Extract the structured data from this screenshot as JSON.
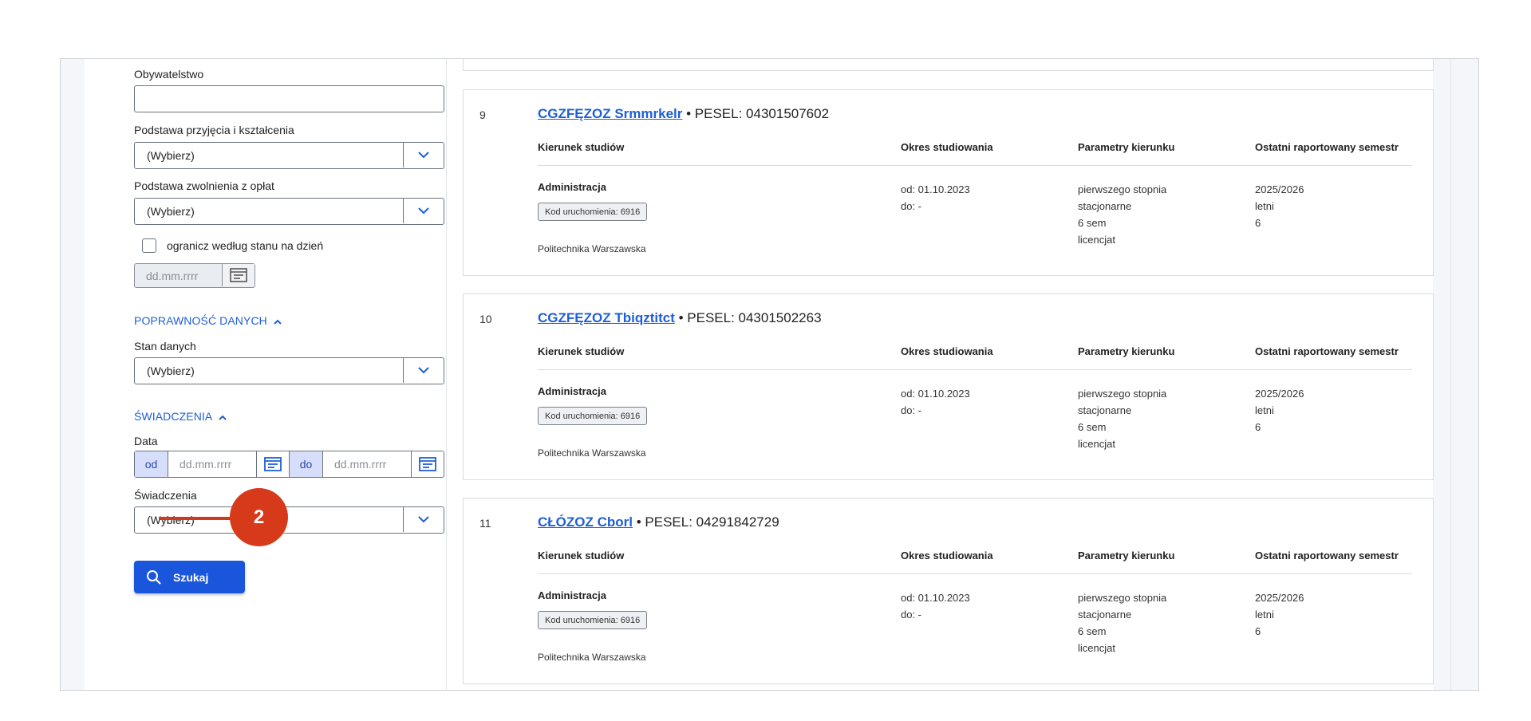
{
  "filters": {
    "obywatelstwo_label": "Obywatelstwo",
    "obywatelstwo_value": "",
    "podstawa_przyjecia_label": "Podstawa przyjęcia i kształcenia",
    "podstawa_przyjecia_value": "(Wybierz)",
    "podstawa_zwolnienia_label": "Podstawa zwolnienia z opłat",
    "podstawa_zwolnienia_value": "(Wybierz)",
    "ogranicz_label": "ogranicz według stanu na dzień",
    "ogranicz_checked": false,
    "stan_na_dzien_placeholder": "dd.mm.rrrr",
    "poprawnosc_section": "POPRAWNOŚĆ DANYCH",
    "stan_danych_label": "Stan danych",
    "stan_danych_value": "(Wybierz)",
    "swiadczenia_section": "ŚWIADCZENIA",
    "data_label": "Data",
    "od_tag": "od",
    "do_tag": "do",
    "od_placeholder": "dd.mm.rrrr",
    "do_placeholder": "dd.mm.rrrr",
    "swiadczenia_label": "Świadczenia",
    "swiadczenia_value": "(Wybierz)",
    "search_button": "Szukaj"
  },
  "callout": {
    "number": "2",
    "color": "#d73a1a"
  },
  "columns": {
    "kierunek": "Kierunek studiów",
    "okres": "Okres studiowania",
    "parametry": "Parametry kierunku",
    "semestr": "Ostatni raportowany semestr"
  },
  "results": [
    {
      "num": "9",
      "name": "CGZFĘZOZ Srmmrkelr",
      "pesel": "• PESEL: 04301507602",
      "kierunek": "Administracja",
      "kod": "Kod uruchomienia: 6916",
      "uczelnia": "Politechnika Warszawska",
      "od": "od: 01.10.2023",
      "do": "do: -",
      "stopien": "pierwszego stopnia",
      "forma": "stacjonarne",
      "sem": "6 sem",
      "tytul": "licencjat",
      "rok": "2025/2026",
      "semestr": "letni",
      "nr_sem": "6"
    },
    {
      "num": "10",
      "name": "CGZFĘZOZ Tbiqztitct",
      "pesel": "• PESEL: 04301502263",
      "kierunek": "Administracja",
      "kod": "Kod uruchomienia: 6916",
      "uczelnia": "Politechnika Warszawska",
      "od": "od: 01.10.2023",
      "do": "do: -",
      "stopien": "pierwszego stopnia",
      "forma": "stacjonarne",
      "sem": "6 sem",
      "tytul": "licencjat",
      "rok": "2025/2026",
      "semestr": "letni",
      "nr_sem": "6"
    },
    {
      "num": "11",
      "name": "CŁÓZOZ Cborl",
      "pesel": "• PESEL: 04291842729",
      "kierunek": "Administracja",
      "kod": "Kod uruchomienia: 6916",
      "uczelnia": "Politechnika Warszawska",
      "od": "od: 01.10.2023",
      "do": "do: -",
      "stopien": "pierwszego stopnia",
      "forma": "stacjonarne",
      "sem": "6 sem",
      "tytul": "licencjat",
      "rok": "2025/2026",
      "semestr": "letni",
      "nr_sem": "6"
    }
  ],
  "icons": {
    "chevron": "chevron-down-icon",
    "calendar": "calendar-icon",
    "search": "search-icon",
    "caret_up": "caret-up-icon"
  },
  "colors": {
    "accent": "#1e5fd6",
    "button": "#1a56db",
    "callout": "#d73a1a"
  }
}
